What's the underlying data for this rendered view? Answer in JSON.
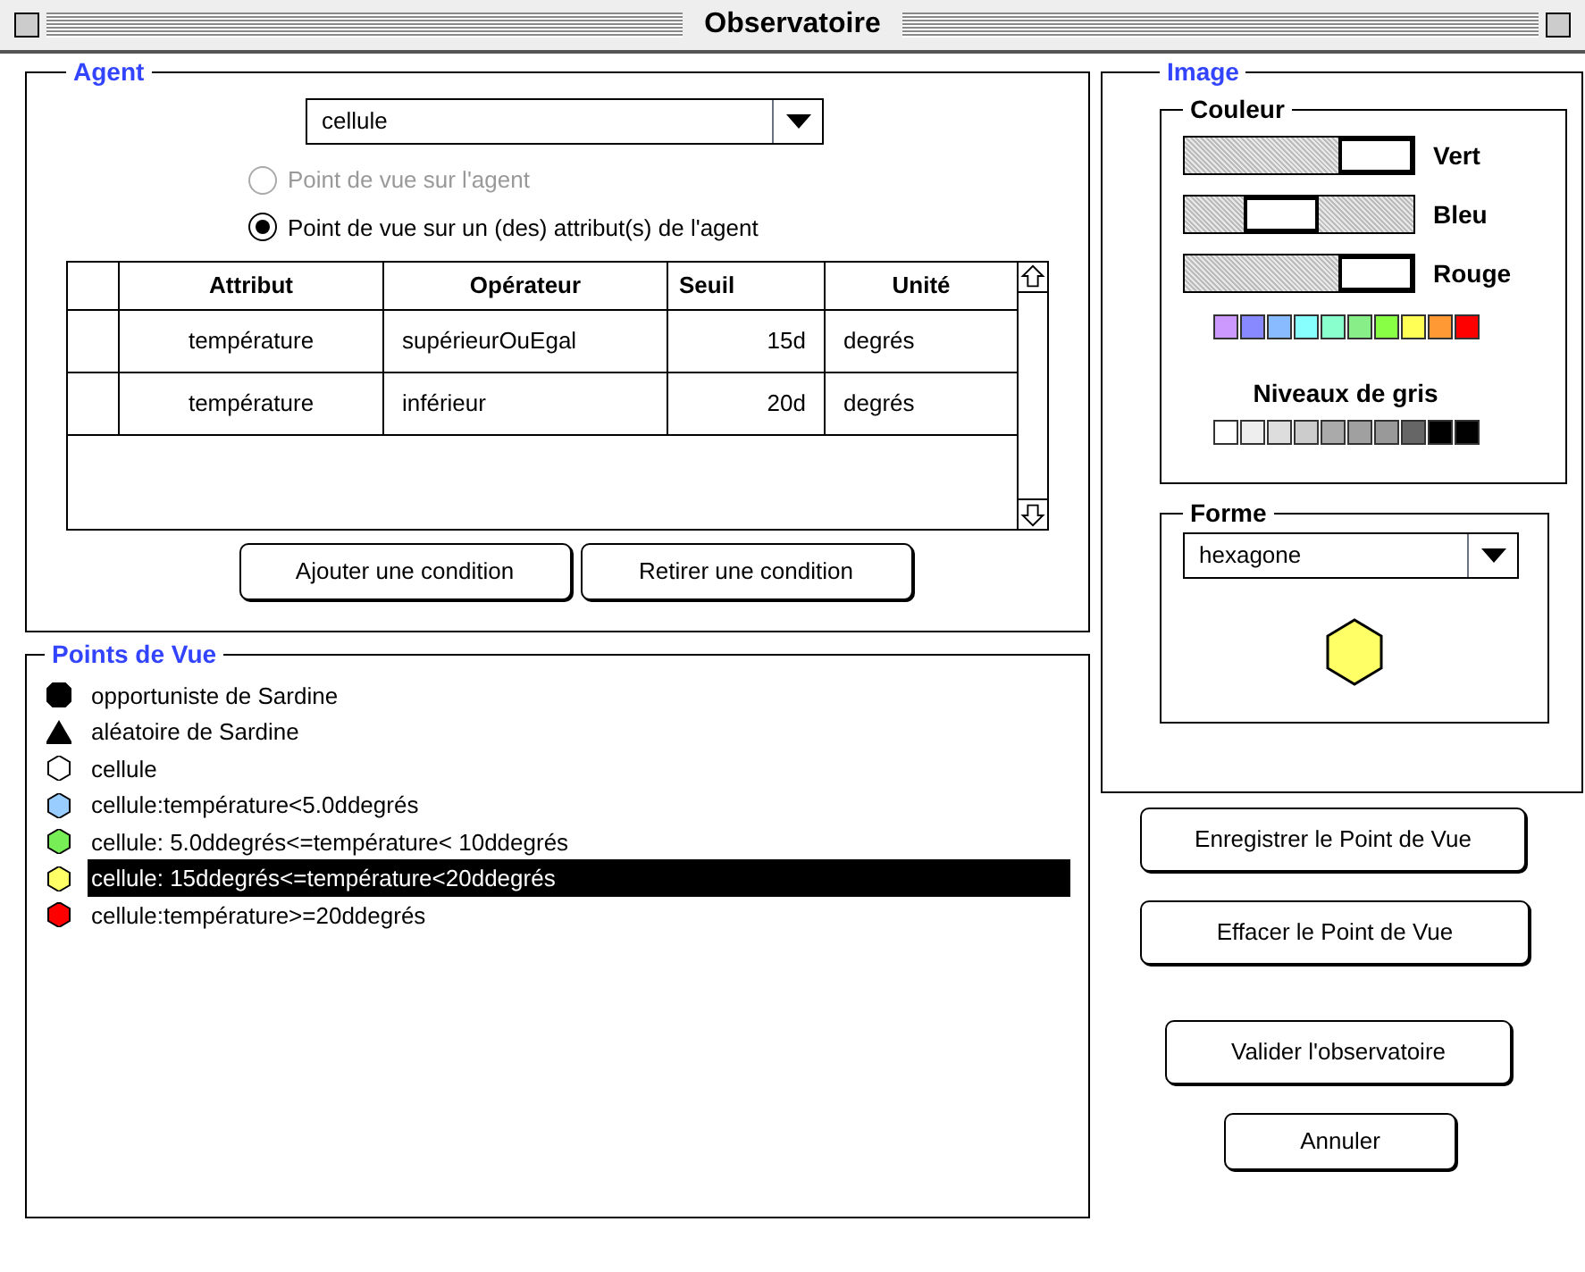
{
  "window": {
    "title": "Observatoire"
  },
  "agent": {
    "title": "Agent",
    "dropdown": {
      "value": "cellule"
    },
    "options": [
      {
        "label": "Point de vue sur l'agent",
        "selected": false,
        "disabled": true
      },
      {
        "label": "Point de vue sur un (des) attribut(s) de l'agent",
        "selected": true,
        "disabled": false
      }
    ],
    "table": {
      "columns": [
        "Attribut",
        "Opérateur",
        "Seuil",
        "Unité"
      ],
      "rows": [
        [
          "température",
          "supérieurOuEgal",
          "15d",
          "degrés"
        ],
        [
          "température",
          "inférieur",
          "20d",
          "degrés"
        ]
      ]
    },
    "buttons": [
      "Ajouter une condition",
      "Retirer une condition"
    ]
  },
  "points_de_vue": {
    "title": "Points de Vue",
    "items": [
      {
        "label": "opportuniste de Sardine",
        "kind": "octagon",
        "color": "#000000",
        "selected": false
      },
      {
        "label": "aléatoire de Sardine",
        "kind": "triangle",
        "color": "#000000",
        "selected": false
      },
      {
        "label": "cellule",
        "kind": "hexagon",
        "color": "#ffffff",
        "selected": false
      },
      {
        "label": "cellule:température<5.0ddegrés",
        "kind": "hexagon",
        "color": "#99ccff",
        "selected": false
      },
      {
        "label": "cellule: 5.0ddegrés<=température< 10ddegrés",
        "kind": "hexagon",
        "color": "#77ee55",
        "selected": false
      },
      {
        "label": "cellule: 15ddegrés<=température<20ddegrés",
        "kind": "hexagon",
        "color": "#ffff66",
        "selected": true
      },
      {
        "label": "cellule:température>=20ddegrés",
        "kind": "hexagon",
        "color": "#ff0000",
        "selected": false
      }
    ]
  },
  "image": {
    "title": "Image",
    "couleur": {
      "title": "Couleur",
      "sliders": [
        {
          "label": "Vert",
          "level": 1
        },
        {
          "label": "Bleu",
          "level": 0.38
        },
        {
          "label": "Rouge",
          "level": 1
        }
      ],
      "swatches": [
        {
          "color": "#cc99ff"
        },
        {
          "color": "#8888ff"
        },
        {
          "color": "#88bbff"
        },
        {
          "color": "#88ffff"
        },
        {
          "color": "#88ffcc"
        },
        {
          "color": "#88ee88"
        },
        {
          "color": "#88ff44"
        },
        {
          "color": "#ffff55"
        },
        {
          "color": "#ff9933"
        },
        {
          "color": "#ff0000"
        }
      ],
      "grey_title": "Niveaux de gris",
      "greys": [
        {
          "color": "#ffffff"
        },
        {
          "color": "#eeeeee"
        },
        {
          "color": "#dddddd"
        },
        {
          "color": "#cccccc"
        },
        {
          "color": "#aaaaaa"
        },
        {
          "color": "#a0a0a0"
        },
        {
          "color": "#999999"
        },
        {
          "color": "#666666"
        },
        {
          "color": "#000000"
        },
        {
          "color": "#010101"
        }
      ]
    },
    "forme": {
      "title": "Forme",
      "dropdown": {
        "value": "hexagone"
      }
    }
  },
  "actions": [
    "Enregistrer le Point de Vue",
    "Effacer le Point de Vue",
    "Valider l'observatoire",
    "Annuler"
  ]
}
